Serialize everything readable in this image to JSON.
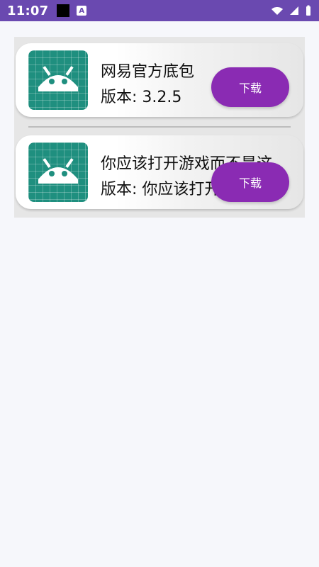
{
  "status_bar": {
    "time": "11:07",
    "notification_letter": "A",
    "icons": {
      "wifi": "wifi-icon",
      "signal": "cell-signal-icon",
      "battery": "battery-icon"
    },
    "color": "#6a49b0"
  },
  "items": [
    {
      "title": "网易官方底包",
      "version_prefix": "版本:",
      "version_value": "3.2.5",
      "download_label": "下载"
    },
    {
      "title": "你应该打开游戏而不是这.",
      "version_prefix": "版本:",
      "version_value": "你应该打开游戏而",
      "download_label": "下载"
    }
  ],
  "colors": {
    "accent_button": "#8a2bb3",
    "icon_bg": "#1f8f7f",
    "background": "#f6f7fb"
  }
}
